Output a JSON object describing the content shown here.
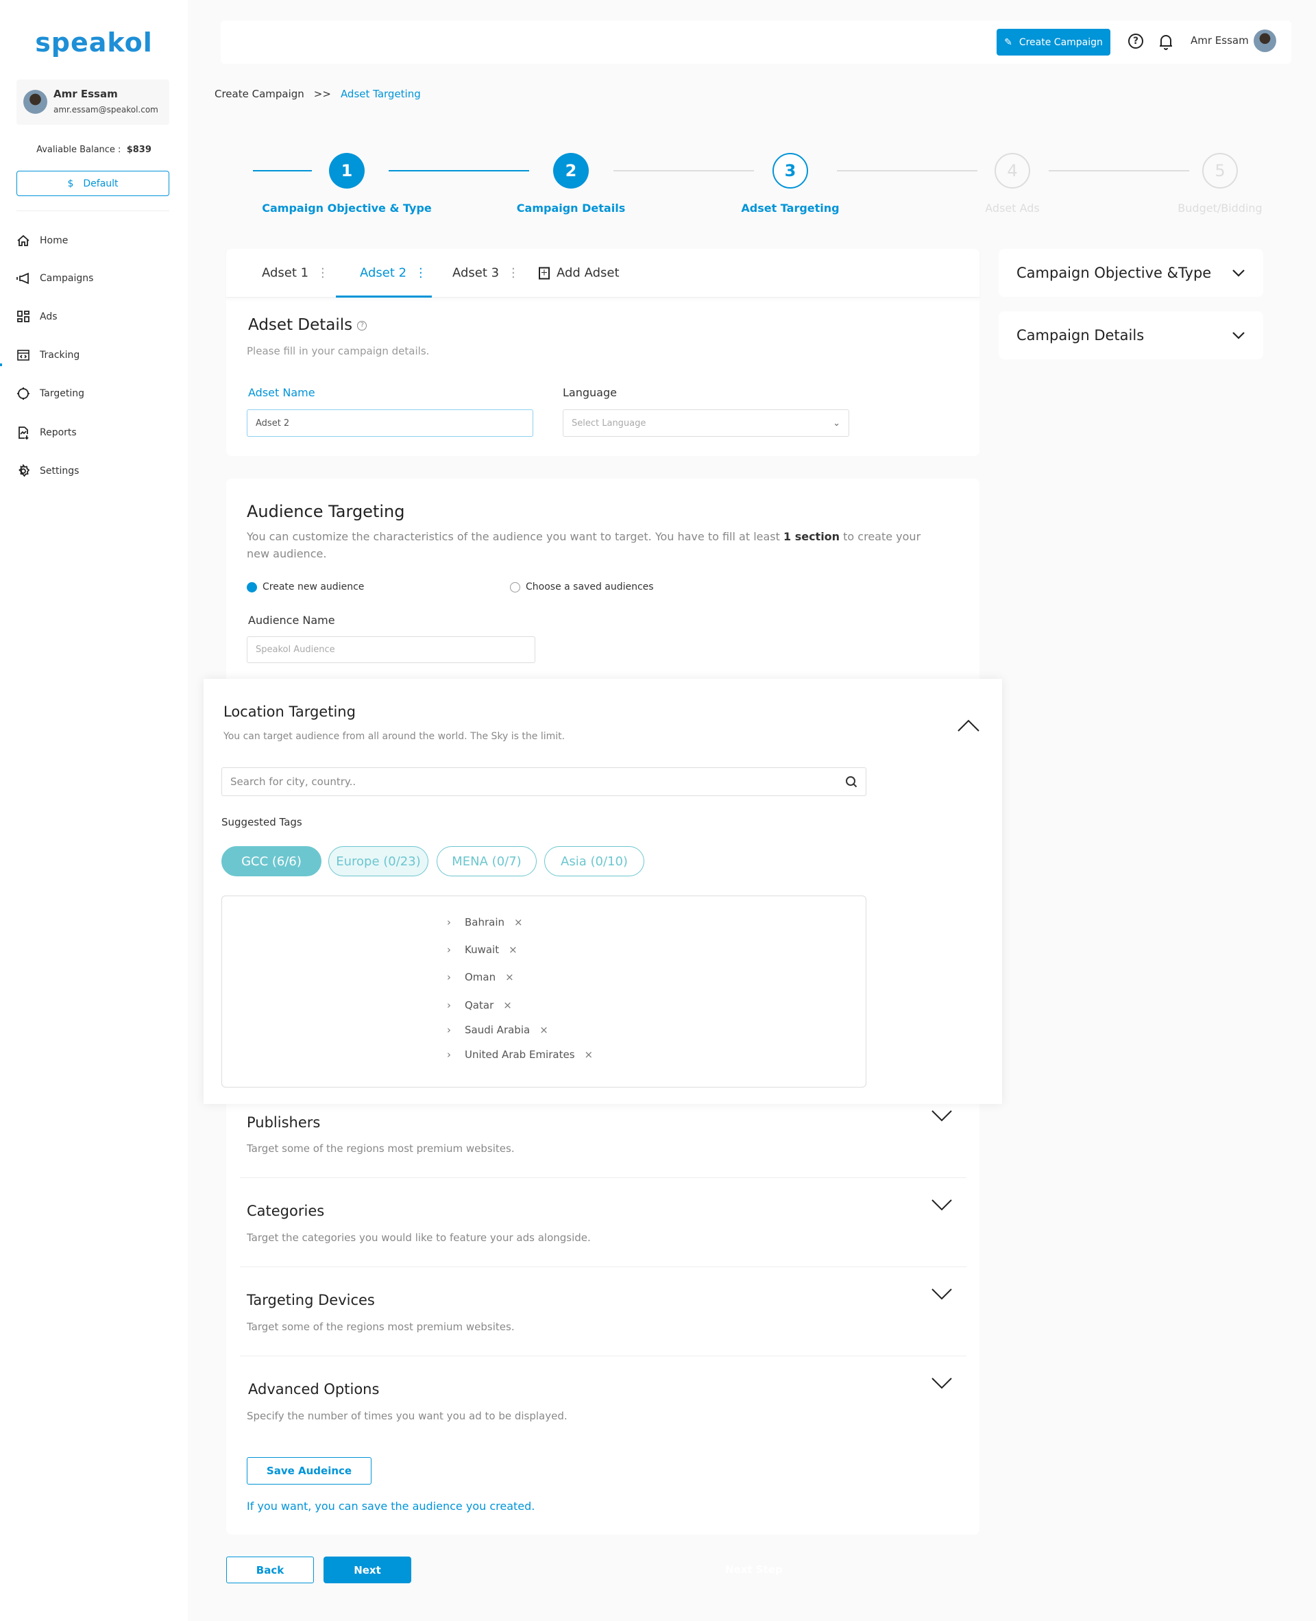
{
  "sidebar": {
    "logo": "speakol",
    "user_name": "Amr Essam",
    "user_email": "amr.essam@speakol.com",
    "balance_label": "Avaliable Balance :",
    "balance_value": "$839",
    "default_button": "Default",
    "default_icon": "dollar-icon",
    "items": [
      {
        "label": "Home",
        "icon": "home-icon"
      },
      {
        "label": "Campaigns",
        "icon": "megaphone-icon"
      },
      {
        "label": "Ads",
        "icon": "grid-icon"
      },
      {
        "label": "Tracking",
        "icon": "code-window-icon"
      },
      {
        "label": "Targeting",
        "icon": "crosshair-icon"
      },
      {
        "label": "Reports",
        "icon": "report-icon"
      },
      {
        "label": "Settings",
        "icon": "gear-icon"
      }
    ]
  },
  "topbar": {
    "create_campaign": "Create Campaign",
    "user_name": "Amr Essam"
  },
  "breadcrumb": {
    "items": [
      "Create Campaign",
      "Adset Targeting"
    ],
    "separator": ">>"
  },
  "stepper": {
    "current": 3,
    "steps": [
      {
        "n": "1",
        "label": "Campaign Objective & Type"
      },
      {
        "n": "2",
        "label": "Campaign Details"
      },
      {
        "n": "3",
        "label": "Adset Targeting"
      },
      {
        "n": "4",
        "label": "Adset Ads"
      },
      {
        "n": "5",
        "label": "Budget/Bidding"
      }
    ]
  },
  "tabs": {
    "items": [
      "Adset 1",
      "Adset 2",
      "Adset 3"
    ],
    "active": "Adset 2",
    "add": "Add Adset"
  },
  "adset_details": {
    "title": "Adset Details",
    "subtitle": "Please fill in your campaign details.",
    "name_label": "Adset Name",
    "name_value": "Adset 2",
    "language_label": "Language",
    "language_placeholder": "Select Language"
  },
  "right_panels": [
    "Campaign Objective &Type",
    "Campaign Details"
  ],
  "audience": {
    "title": "Audience Targeting",
    "desc_pre": "You can customize the characteristics of the audience you want to target. You have to fill at least ",
    "desc_bold": "1 section",
    "desc_post": " to create your new audience.",
    "radio_new": "Create new audience",
    "radio_saved": "Choose a saved audiences",
    "selected_radio": "Create new audience",
    "name_label": "Audience Name",
    "name_placeholder": "Speakol Audience"
  },
  "location": {
    "title": "Location Targeting",
    "subtitle": "You can  target audience from all around the world. The Sky is the limit.",
    "search_placeholder": "Search for city, country..",
    "tags_label": "Suggested Tags",
    "tags": [
      {
        "label": "GCC (6/6)",
        "state": "selected"
      },
      {
        "label": "Europe (0/23)",
        "state": "hover"
      },
      {
        "label": "MENA (0/7)",
        "state": "default"
      },
      {
        "label": "Asia (0/10)",
        "state": "default"
      }
    ],
    "countries": [
      "Bahrain",
      "Kuwait",
      "Oman",
      "Qatar",
      "Saudi Arabia",
      "United Arab Emirates"
    ],
    "accent": "#6cc6cf"
  },
  "sections": [
    {
      "title": "Publishers",
      "subtitle": "Target some of the regions most premium websites."
    },
    {
      "title": "Categories",
      "subtitle": "Target the categories you would like to feature your ads alongside."
    },
    {
      "title": "Targeting Devices",
      "subtitle": "Target some of the regions most premium websites."
    },
    {
      "title": "Advanced Options",
      "subtitle": "Specify the number of times you want you ad to be displayed."
    }
  ],
  "save_audience": "Save Audeince",
  "save_hint": "If you want, you can save the audience you created.",
  "footer": {
    "back": "Back",
    "next": "Next",
    "next_step": "Next Step"
  },
  "colors": {
    "primary": "#0094d8",
    "tag": "#6cc6cf"
  }
}
